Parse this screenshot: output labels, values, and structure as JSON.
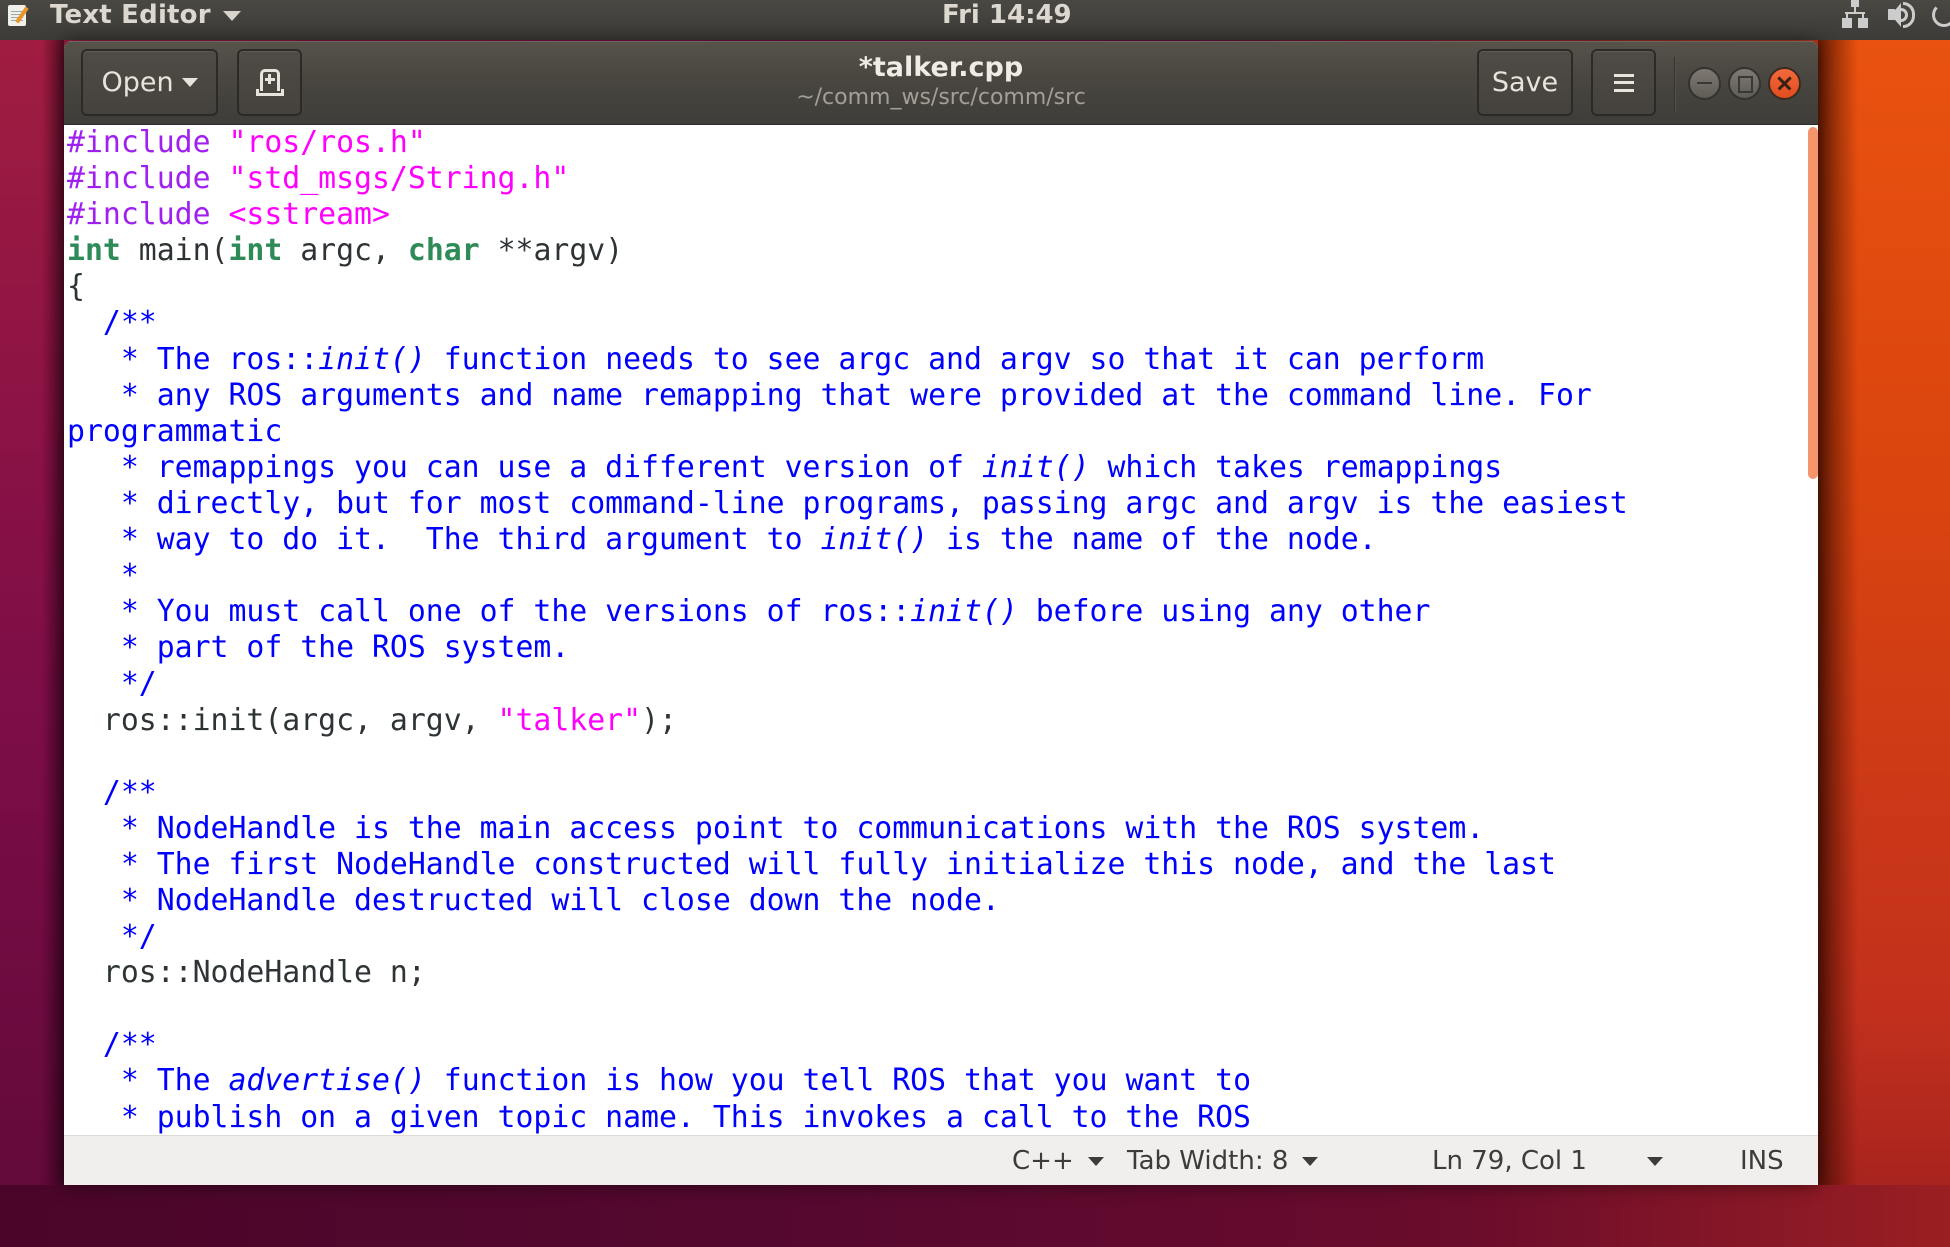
{
  "top_panel": {
    "app_name": "Text Editor",
    "clock": "Fri 14:49",
    "tray_icons": [
      "network-icon",
      "volume-icon",
      "power-icon"
    ]
  },
  "window": {
    "title": "*talker.cpp",
    "subtitle": "~/comm_ws/src/comm/src",
    "open_label": "Open",
    "save_label": "Save",
    "new_tab_icon": "new-document-icon",
    "menu_icon": "hamburger-menu-icon",
    "controls": [
      "minimize",
      "maximize",
      "close"
    ]
  },
  "editor": {
    "lines": [
      [
        [
          "pre",
          "#include "
        ],
        [
          "str",
          "\"ros/ros.h\""
        ]
      ],
      [
        [
          "pre",
          "#include "
        ],
        [
          "str",
          "\"std_msgs/String.h\""
        ]
      ],
      [
        [
          "pre",
          "#include "
        ],
        [
          "str",
          "<sstream>"
        ]
      ],
      [
        [
          "type",
          "int"
        ],
        [
          "plain",
          " main("
        ],
        [
          "type",
          "int"
        ],
        [
          "plain",
          " argc, "
        ],
        [
          "type",
          "char"
        ],
        [
          "plain",
          " **argv)"
        ]
      ],
      [
        [
          "plain",
          "{"
        ]
      ],
      [
        [
          "com",
          "  /**"
        ]
      ],
      [
        [
          "com",
          "   * The ros::"
        ],
        [
          "com-em",
          "init()"
        ],
        [
          "com",
          " function needs to see argc and argv so that it can perform"
        ]
      ],
      [
        [
          "com",
          "   * any ROS arguments and name remapping that were provided at the command line. For"
        ]
      ],
      [
        [
          "com",
          "programmatic"
        ]
      ],
      [
        [
          "com",
          "   * remappings you can use a different version of "
        ],
        [
          "com-em",
          "init()"
        ],
        [
          "com",
          " which takes remappings"
        ]
      ],
      [
        [
          "com",
          "   * directly, but for most command-line programs, passing argc and argv is the easiest"
        ]
      ],
      [
        [
          "com",
          "   * way to do it.  The third argument to "
        ],
        [
          "com-em",
          "init()"
        ],
        [
          "com",
          " is the name of the node."
        ]
      ],
      [
        [
          "com",
          "   *"
        ]
      ],
      [
        [
          "com",
          "   * You must call one of the versions of ros::"
        ],
        [
          "com-em",
          "init()"
        ],
        [
          "com",
          " before using any other"
        ]
      ],
      [
        [
          "com",
          "   * part of the ROS system."
        ]
      ],
      [
        [
          "com",
          "   */"
        ]
      ],
      [
        [
          "plain",
          "  ros::init(argc, argv, "
        ],
        [
          "str",
          "\"talker\""
        ],
        [
          "plain",
          ");"
        ]
      ],
      [
        [
          "plain",
          ""
        ]
      ],
      [
        [
          "com",
          "  /**"
        ]
      ],
      [
        [
          "com",
          "   * NodeHandle is the main access point to communications with the ROS system."
        ]
      ],
      [
        [
          "com",
          "   * The first NodeHandle constructed will fully initialize this node, and the last"
        ]
      ],
      [
        [
          "com",
          "   * NodeHandle destructed will close down the node."
        ]
      ],
      [
        [
          "com",
          "   */"
        ]
      ],
      [
        [
          "plain",
          "  ros::NodeHandle n;"
        ]
      ],
      [
        [
          "plain",
          ""
        ]
      ],
      [
        [
          "com",
          "  /**"
        ]
      ],
      [
        [
          "com",
          "   * The "
        ],
        [
          "com-em",
          "advertise()"
        ],
        [
          "com",
          " function is how you tell ROS that you want to"
        ]
      ],
      [
        [
          "com",
          "   * publish on a given topic name. This invokes a call to the ROS"
        ]
      ]
    ],
    "scroll_fraction_visible": 0.35,
    "scroll_position": 0.0
  },
  "statusbar": {
    "language": "C++",
    "tab_width": "Tab Width: 8",
    "position": "Ln 79, Col 1",
    "mode": "INS"
  },
  "colors": {
    "preprocessor": "#a020f0",
    "string": "#ff00ff",
    "type": "#2e8b57",
    "comment": "#0000ff",
    "accent": "#e95420",
    "scroll_thumb": "#f5956b"
  }
}
